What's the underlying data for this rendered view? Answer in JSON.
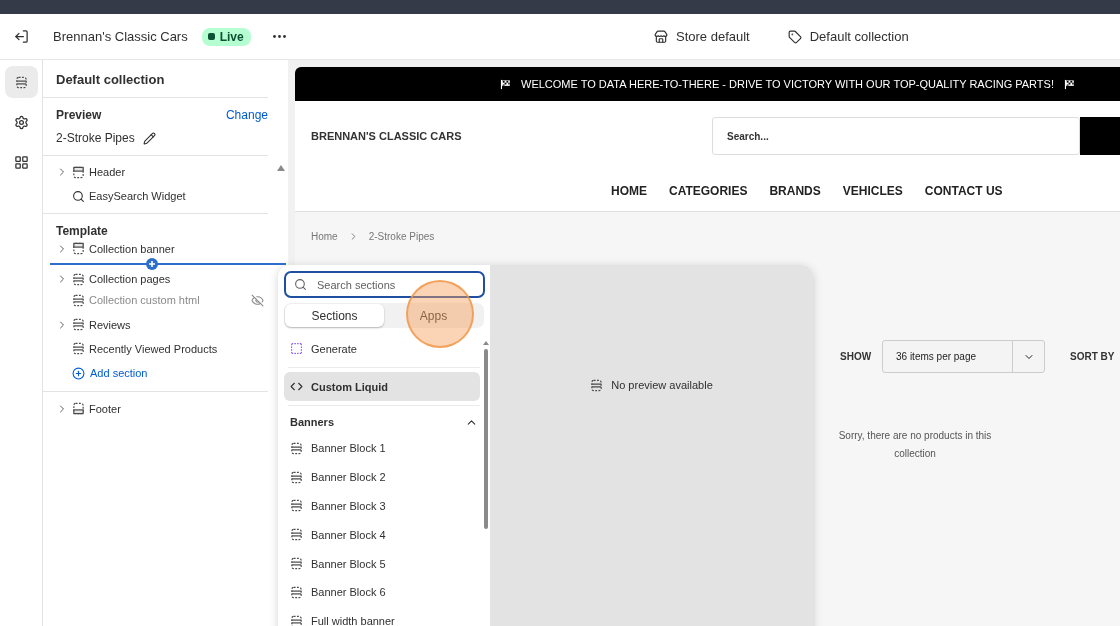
{
  "topbar": {
    "store_name": "Brennan's Classic Cars",
    "status": "Live",
    "center": [
      {
        "kind": "store",
        "label": "Store default"
      },
      {
        "kind": "tag",
        "label": "Default collection"
      }
    ]
  },
  "rail": [
    {
      "kind": "sections",
      "selected": true
    },
    {
      "kind": "settings",
      "selected": false
    },
    {
      "kind": "apps",
      "selected": false
    }
  ],
  "sidebar": {
    "title": "Default collection",
    "preview_label": "Preview",
    "change_link": "Change",
    "preview_value": "2-Stroke Pipes",
    "header_group": [
      {
        "kind": "header",
        "label": "Header",
        "expandable": true
      },
      {
        "kind": "search",
        "label": "EasySearch Widget",
        "expandable": false
      }
    ],
    "template_title": "Template",
    "template_items": [
      {
        "kind": "header",
        "label": "Collection banner",
        "expandable": true,
        "hidden": false,
        "insert_after": true
      },
      {
        "kind": "section",
        "label": "Collection pages",
        "expandable": true,
        "hidden": false,
        "insert_after": false
      },
      {
        "kind": "section",
        "label": "Collection custom html",
        "expandable": false,
        "hidden": true,
        "insert_after": false
      },
      {
        "kind": "section",
        "label": "Reviews",
        "expandable": true,
        "hidden": false,
        "insert_after": false
      },
      {
        "kind": "section",
        "label": "Recently Viewed Products",
        "expandable": false,
        "hidden": false,
        "insert_after": false
      }
    ],
    "add_section": "Add section",
    "footer_group": [
      {
        "kind": "footer",
        "label": "Footer",
        "expandable": true
      }
    ]
  },
  "store": {
    "announcement": "WELCOME TO DATA HERE-TO-THERE - DRIVE TO VICTORY WITH OUR TOP-QUALITY RACING PARTS!",
    "logo": "BRENNAN'S CLASSIC CARS",
    "search_placeholder": "Search...",
    "nav": [
      "HOME",
      "CATEGORIES",
      "BRANDS",
      "VEHICLES",
      "CONTACT US"
    ],
    "breadcrumb": [
      "Home",
      "2-Stroke Pipes"
    ],
    "show_label": "SHOW",
    "per_page": "36 items per page",
    "sort_label": "SORT BY",
    "empty_message": "Sorry, there are no products in this collection"
  },
  "picker": {
    "search_placeholder": "Search sections",
    "tabs": [
      {
        "label": "Sections",
        "selected": true
      },
      {
        "label": "Apps",
        "selected": false
      }
    ],
    "generate": "Generate",
    "items": [
      {
        "kind": "code",
        "label": "Custom Liquid",
        "selected": true
      }
    ],
    "group": {
      "title": "Banners",
      "expanded": true,
      "items": [
        "Banner Block 1",
        "Banner Block 2",
        "Banner Block 3",
        "Banner Block 4",
        "Banner Block 5",
        "Banner Block 6",
        "Full width banner"
      ]
    },
    "preview_message": "No preview available"
  }
}
